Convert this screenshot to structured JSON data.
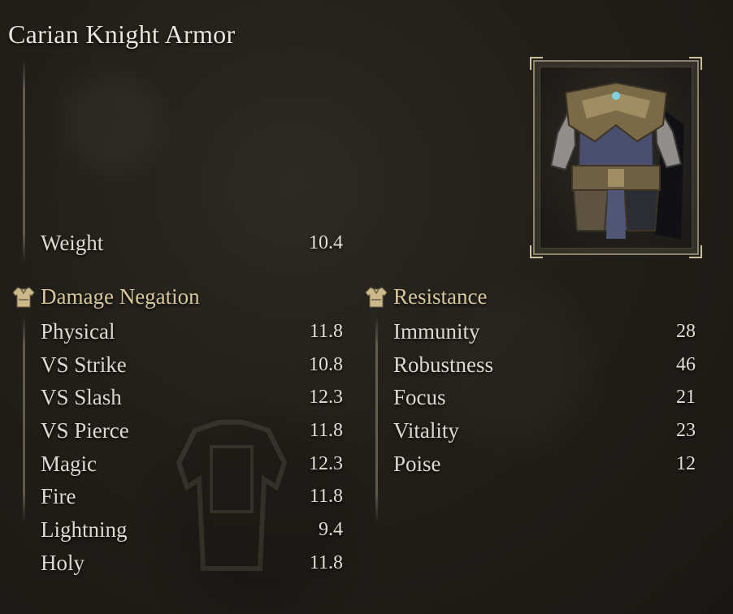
{
  "item": {
    "name": "Carian Knight Armor",
    "image_icon": "chest-armor-icon"
  },
  "weight": {
    "label": "Weight",
    "value": "10.4"
  },
  "damage_negation": {
    "heading": "Damage Negation",
    "icon": "chest-armor-icon",
    "stats": [
      {
        "label": "Physical",
        "value": "11.8"
      },
      {
        "label": "VS Strike",
        "value": "10.8"
      },
      {
        "label": "VS Slash",
        "value": "12.3"
      },
      {
        "label": "VS Pierce",
        "value": "11.8"
      },
      {
        "label": "Magic",
        "value": "12.3"
      },
      {
        "label": "Fire",
        "value": "11.8"
      },
      {
        "label": "Lightning",
        "value": "9.4"
      },
      {
        "label": "Holy",
        "value": "11.8"
      }
    ]
  },
  "resistance": {
    "heading": "Resistance",
    "icon": "chest-armor-icon",
    "stats": [
      {
        "label": "Immunity",
        "value": "28"
      },
      {
        "label": "Robustness",
        "value": "46"
      },
      {
        "label": "Focus",
        "value": "21"
      },
      {
        "label": "Vitality",
        "value": "23"
      },
      {
        "label": "Poise",
        "value": "12"
      }
    ]
  },
  "colors": {
    "heading_gold": "#d9c79c",
    "text": "#ddd9cf",
    "background": "#221f1a"
  }
}
